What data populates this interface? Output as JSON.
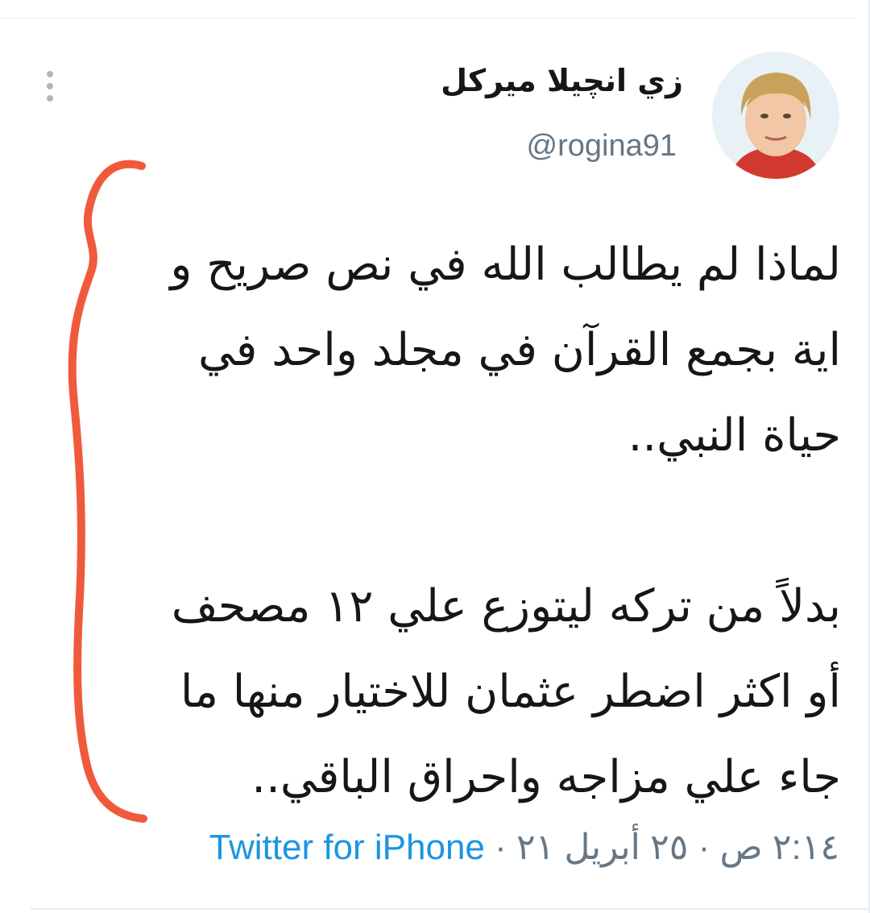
{
  "tweet": {
    "display_name": "زي انچيلا ميركل",
    "handle": "@rogina91",
    "lines": [
      "لماذا لم يطالب الله في نص صريح و",
      "اية بجمع القرآن في مجلد واحد في",
      "حياة النبي..",
      "",
      "بدلاً من تركه ليتوزع علي ١٢ مصحف",
      "أو اكثر اضطر عثمان للاختيار منها ما",
      "جاء علي مزاجه واحراق الباقي.."
    ],
    "time": "٢:١٤ ص",
    "separator": "·",
    "date": "٢٥ أبريل ٢١",
    "source": "Twitter for iPhone"
  },
  "icons": {
    "more": "more-vertical-icon",
    "annotation": "red-brace-annotation"
  },
  "colors": {
    "text": "#14171a",
    "secondary": "#657786",
    "link": "#1b95e0",
    "annotation": "#f05a3c"
  }
}
